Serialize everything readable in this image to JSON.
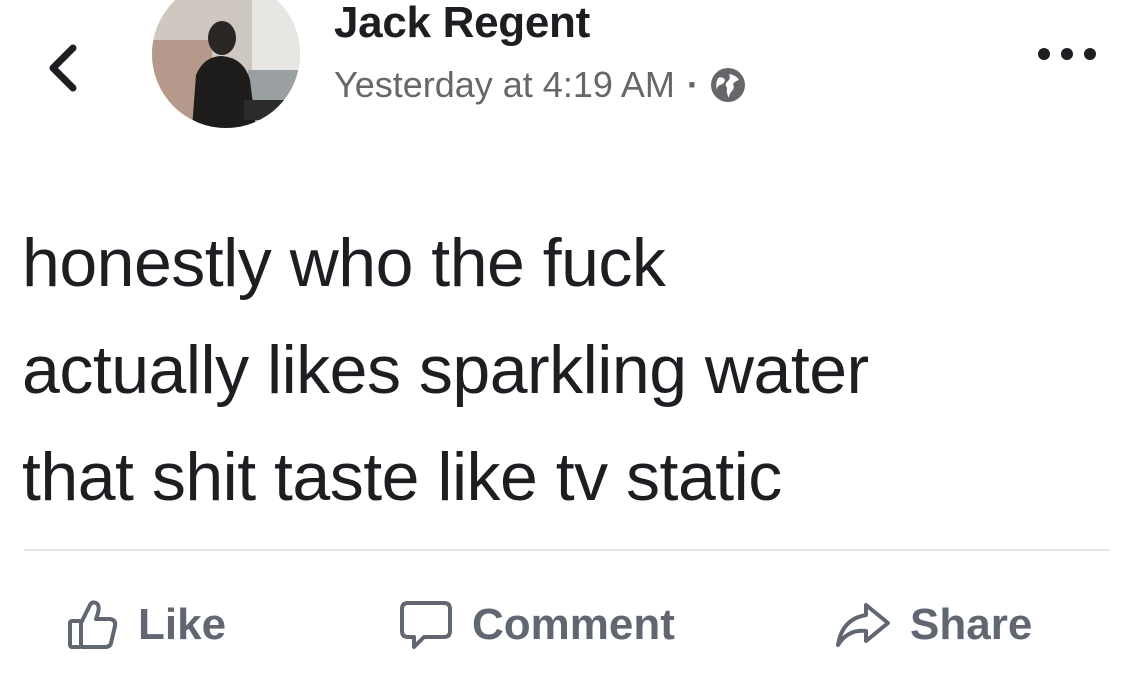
{
  "post": {
    "author": "Jack Regent",
    "timestamp": "Yesterday at 4:19 AM",
    "separator": "·",
    "privacy_icon": "globe-icon",
    "text_lines": [
      "honestly who the fuck",
      "actually likes sparkling water",
      "that shit taste like tv static"
    ]
  },
  "nav": {
    "back_icon": "chevron-left-icon",
    "more_icon": "more-options-icon"
  },
  "actions": {
    "like_label": "Like",
    "comment_label": "Comment",
    "share_label": "Share"
  },
  "colors": {
    "text_primary": "#1c1e21",
    "text_secondary": "#65676b",
    "action_text": "#606770",
    "divider": "#e4e6eb"
  }
}
